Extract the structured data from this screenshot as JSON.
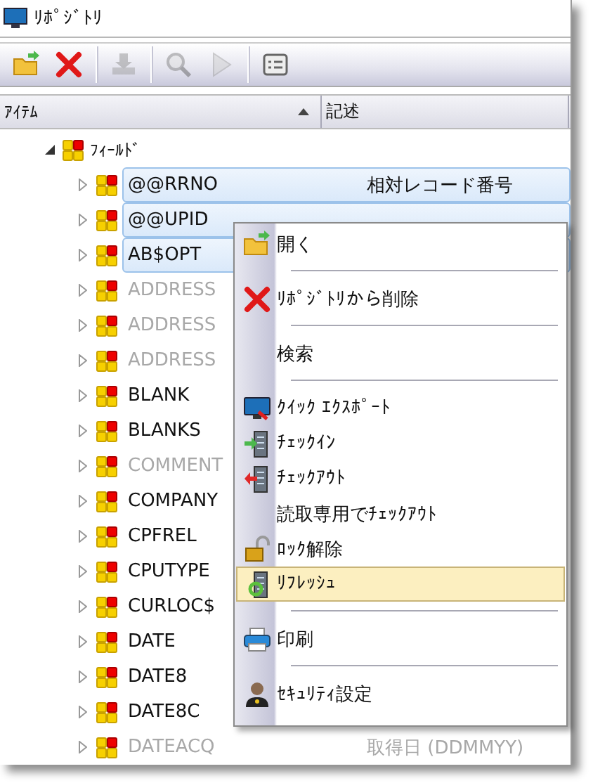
{
  "window": {
    "title": "ﾘﾎﾟｼﾞﾄﾘ"
  },
  "toolbar": {
    "groups": [
      [
        {
          "kind": "open",
          "disabled": false
        },
        {
          "kind": "delete",
          "disabled": false
        }
      ],
      [
        {
          "kind": "download",
          "disabled": true
        }
      ],
      [
        {
          "kind": "search",
          "disabled": true
        },
        {
          "kind": "run",
          "disabled": true
        }
      ],
      [
        {
          "kind": "properties",
          "disabled": false
        }
      ]
    ]
  },
  "table": {
    "columns": [
      {
        "label": "ｱｲﾃﾑ",
        "sorted_ascending": true
      },
      {
        "label": "記述"
      }
    ],
    "tree": {
      "label": "ﾌｨｰﾙﾄﾞ",
      "expanded": true,
      "children": [
        {
          "name": "@@RRNO",
          "description": "相対レコード番号",
          "selected": true,
          "disabled": false,
          "expanded": false
        },
        {
          "name": "@@UPID",
          "selected": true,
          "disabled": false,
          "expanded": false
        },
        {
          "name": "AB$OPT",
          "selected": true,
          "disabled": false,
          "expanded": false
        },
        {
          "name": "ADDRESS",
          "selected": false,
          "disabled": true,
          "expanded": false
        },
        {
          "name": "ADDRESS",
          "selected": false,
          "disabled": true,
          "expanded": false
        },
        {
          "name": "ADDRESS",
          "selected": false,
          "disabled": true,
          "expanded": false
        },
        {
          "name": "BLANK",
          "selected": false,
          "disabled": false,
          "expanded": false
        },
        {
          "name": "BLANKS",
          "selected": false,
          "disabled": false,
          "expanded": false
        },
        {
          "name": "COMMENT",
          "selected": false,
          "disabled": true,
          "expanded": false
        },
        {
          "name": "COMPANY",
          "selected": false,
          "disabled": false,
          "expanded": false
        },
        {
          "name": "CPFREL",
          "selected": false,
          "disabled": false,
          "expanded": false
        },
        {
          "name": "CPUTYPE",
          "selected": false,
          "disabled": false,
          "expanded": false
        },
        {
          "name": "CURLOC$",
          "selected": false,
          "disabled": false,
          "expanded": false
        },
        {
          "name": "DATE",
          "selected": false,
          "disabled": false,
          "expanded": false
        },
        {
          "name": "DATE8",
          "selected": false,
          "disabled": false,
          "expanded": false
        },
        {
          "name": "DATE8C",
          "selected": false,
          "disabled": false,
          "expanded": false
        },
        {
          "name": "DATEACQ",
          "description": "取得日 (DDMMYY)",
          "selected": false,
          "disabled": true,
          "expanded": false
        }
      ]
    }
  },
  "context_menu": {
    "groups": [
      [
        {
          "kind": "open",
          "label": "開く",
          "highlighted": false
        }
      ],
      [
        {
          "kind": "delete",
          "label": "ﾘﾎﾟｼﾞﾄﾘから削除",
          "highlighted": false
        }
      ],
      [
        {
          "kind": "plain",
          "label": "検索",
          "highlighted": false
        }
      ],
      [
        {
          "kind": "export",
          "label": "ｸｲｯｸ ｴｸｽﾎﾟｰﾄ",
          "highlighted": false
        },
        {
          "kind": "checkin",
          "label": "ﾁｪｯｸｲﾝ",
          "highlighted": false
        },
        {
          "kind": "checkout",
          "label": "ﾁｪｯｸｱｳﾄ",
          "highlighted": false
        },
        {
          "kind": "plain",
          "label": "読取専用でﾁｪｯｸｱｳﾄ",
          "highlighted": false
        },
        {
          "kind": "unlock",
          "label": "ﾛｯｸ解除",
          "highlighted": false
        },
        {
          "kind": "refresh",
          "label": "ﾘﾌﾚｯｼｭ",
          "highlighted": true
        }
      ],
      [
        {
          "kind": "print",
          "label": "印刷",
          "highlighted": false
        }
      ],
      [
        {
          "kind": "security",
          "label": "ｾｷｭﾘﾃｨ設定",
          "highlighted": false
        }
      ]
    ]
  }
}
